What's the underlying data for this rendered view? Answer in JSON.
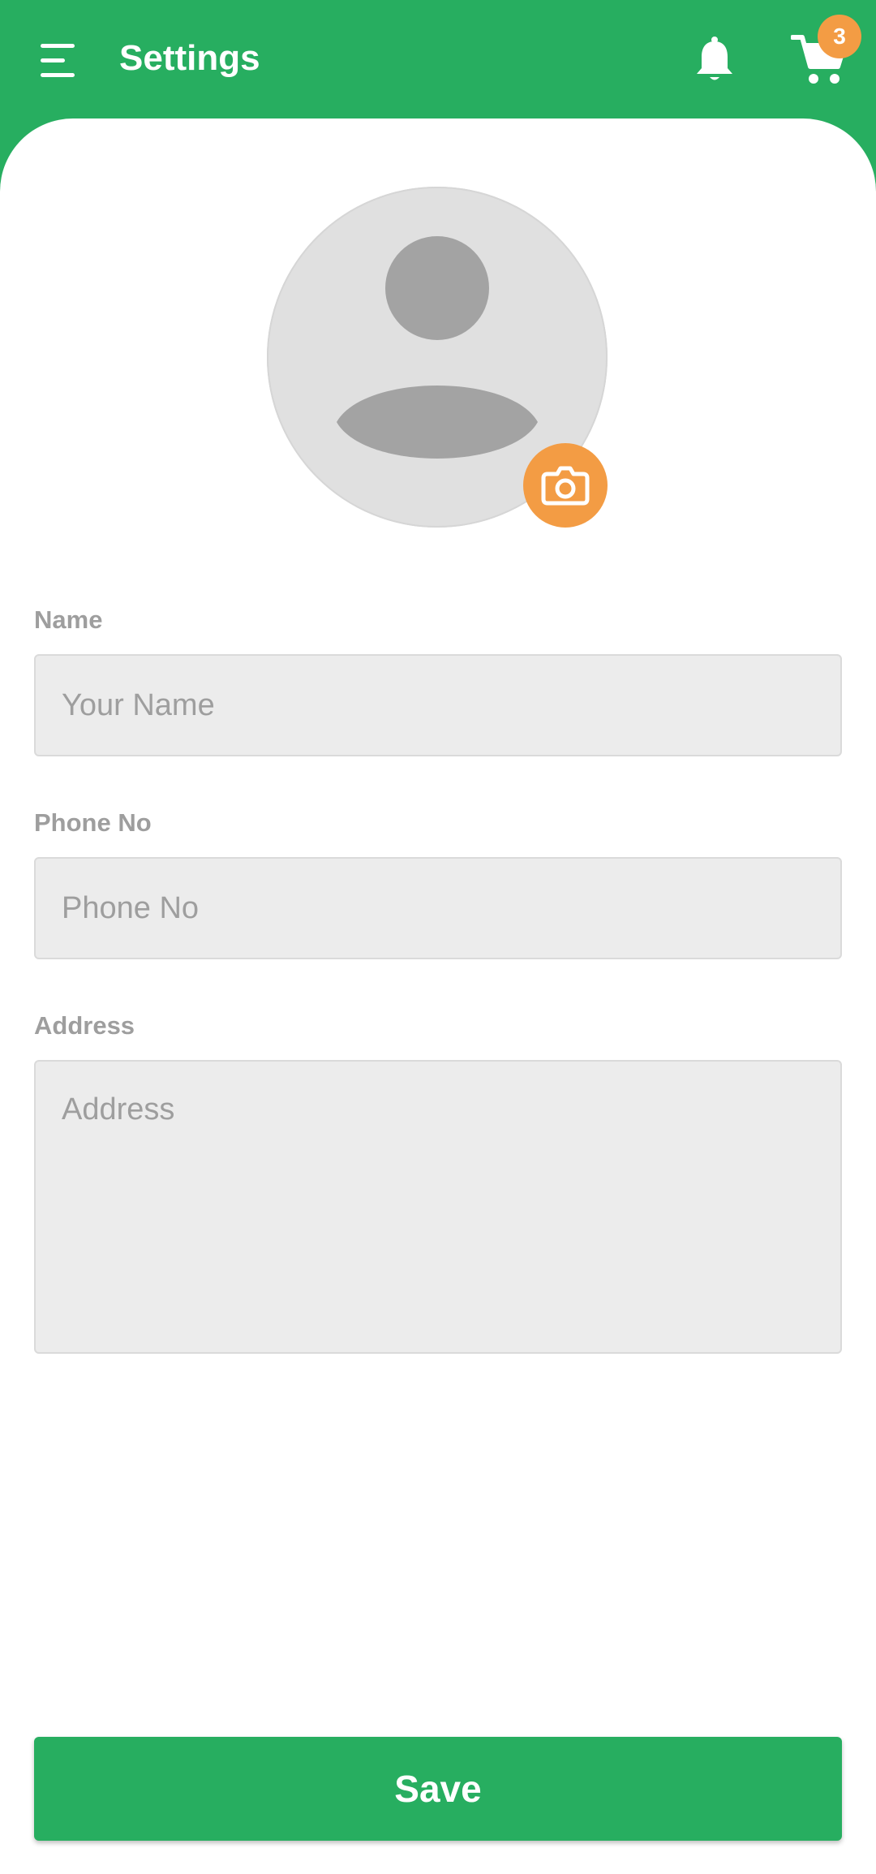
{
  "header": {
    "title": "Settings",
    "cart_count": "3",
    "colors": {
      "brand": "#27ae60",
      "badge": "#f39c44"
    },
    "icons": [
      "menu-icon",
      "bell-icon",
      "cart-icon"
    ]
  },
  "profile": {
    "avatar_icon": "person-placeholder-icon",
    "camera_icon": "camera-icon",
    "camera_color": "#f39c44"
  },
  "form": {
    "name": {
      "label": "Name",
      "placeholder": "Your Name",
      "value": ""
    },
    "phone": {
      "label": "Phone No",
      "placeholder": "Phone No",
      "value": ""
    },
    "address": {
      "label": "Address",
      "placeholder": "Address",
      "value": ""
    }
  },
  "save_label": "Save"
}
